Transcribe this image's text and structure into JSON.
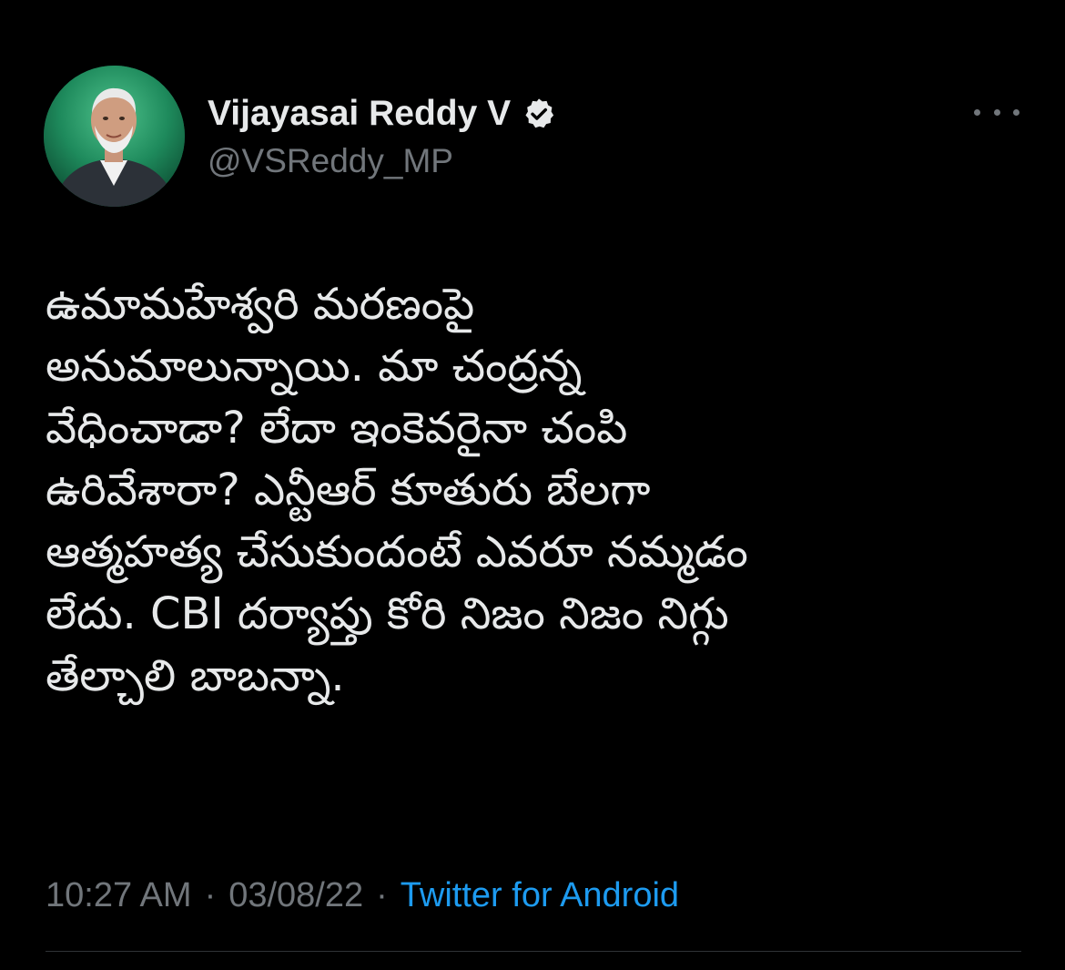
{
  "author": {
    "display_name": "Vijayasai Reddy V",
    "handle": "@VSReddy_MP",
    "verified": true,
    "avatar_icon": "profile-photo",
    "verified_icon": "verified-badge-icon"
  },
  "tweet": {
    "lines": [
      "ఉమామహేశ్వరి మరణంపై",
      "అనుమాలున్నాయి. మా చంద్రన్న",
      "వేధించాడా? లేదా ఇంకెవరైనా చంపి",
      "ఉరివేశారా? ఎన్టీఆర్ కూతురు బేలగా",
      "ఆత్మహత్య చేసుకుందంటే ఎవరూ నమ్మడం",
      "లేదు. CBI దర్యాప్తు కోరి నిజం నిజం నిగ్గు",
      "తేల్చాలి బాబన్నా."
    ]
  },
  "meta": {
    "time": "10:27 AM",
    "separator": "·",
    "date": "03/08/22",
    "source": "Twitter for Android"
  },
  "colors": {
    "background": "#000000",
    "text": "#e7e9ea",
    "muted": "#71767b",
    "link": "#1d9bf0"
  },
  "more_icon": "more-horizontal-icon"
}
